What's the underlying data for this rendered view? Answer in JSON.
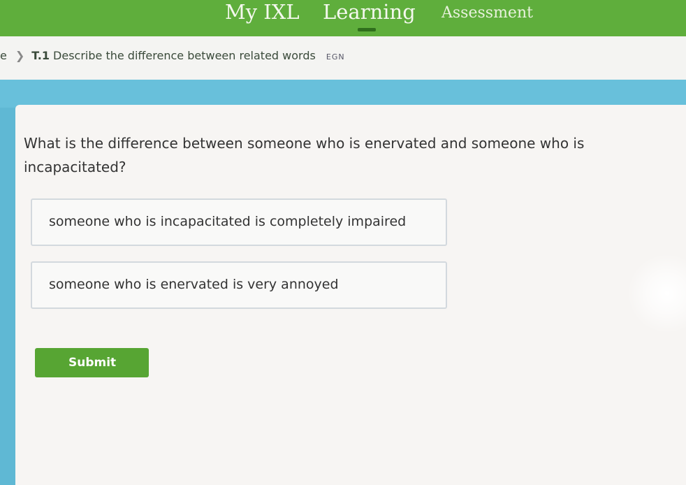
{
  "nav": {
    "my_ixl": "My IXL",
    "learning": "Learning",
    "assessment": "Assessment"
  },
  "breadcrumb": {
    "prev_partial": "e",
    "skill_code": "T.1",
    "skill_title": "Describe the difference between related words",
    "skill_id": "EGN"
  },
  "question": {
    "text": "What is the difference between someone who is enervated and someone who is incapacitated?"
  },
  "choices": [
    "someone who is incapacitated is completely impaired",
    "someone who is enervated is very annoyed"
  ],
  "submit_label": "Submit",
  "colors": {
    "nav_green": "#5fae3c",
    "band_blue": "#68c0db",
    "submit_green": "#57a533"
  }
}
